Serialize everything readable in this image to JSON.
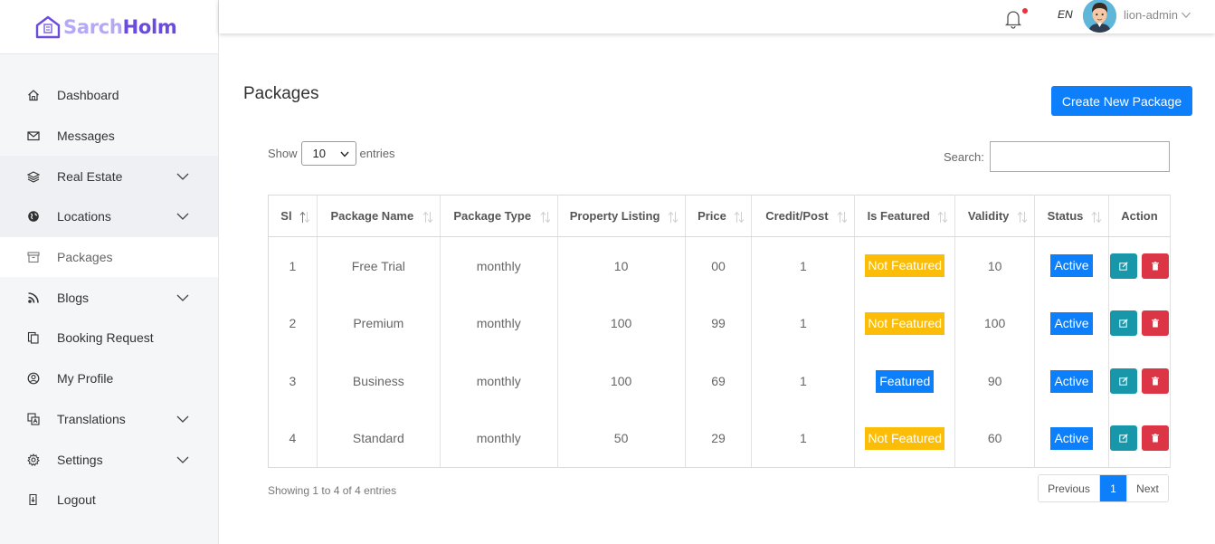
{
  "brand": {
    "part1": "Sarch",
    "part2": "Holm",
    "color_light": "#b5a9f5",
    "color_dark": "#6a4bdc"
  },
  "topbar": {
    "lang": "EN",
    "username": "lion-admin",
    "notification_dot_color": "#e8323c"
  },
  "sidebar": {
    "items": [
      {
        "label": "Dashboard",
        "icon": "home-icon",
        "has_submenu": false
      },
      {
        "label": "Messages",
        "icon": "mail-icon",
        "has_submenu": false
      },
      {
        "label": "Real Estate",
        "icon": "layers-icon",
        "has_submenu": true
      },
      {
        "label": "Locations",
        "icon": "globe-icon",
        "has_submenu": true
      },
      {
        "label": "Packages",
        "icon": "archive-icon",
        "has_submenu": false,
        "active": true
      },
      {
        "label": "Blogs",
        "icon": "rss-icon",
        "has_submenu": true
      },
      {
        "label": "Booking Request",
        "icon": "copy-icon",
        "has_submenu": false
      },
      {
        "label": "My Profile",
        "icon": "user-circle-icon",
        "has_submenu": false
      },
      {
        "label": "Translations",
        "icon": "translate-icon",
        "has_submenu": true
      },
      {
        "label": "Settings",
        "icon": "gear-icon",
        "has_submenu": true
      },
      {
        "label": "Logout",
        "icon": "logout-icon",
        "has_submenu": false
      }
    ]
  },
  "main": {
    "title": "Packages",
    "create_button": "Create New Package",
    "show_label": "Show",
    "page_size": "10",
    "entries_label": "entries",
    "search_label": "Search:",
    "search_value": "",
    "columns": [
      "Sl",
      "Package Name",
      "Package Type",
      "Property Listing",
      "Price",
      "Credit/Post",
      "Is Featured",
      "Validity",
      "Status",
      "Action"
    ],
    "rows": [
      {
        "sl": "1",
        "name": "Free Trial",
        "type": "monthly",
        "listing": "10",
        "price": "00",
        "credit": "1",
        "featured": "Not Featured",
        "validity": "10",
        "status": "Active"
      },
      {
        "sl": "2",
        "name": "Premium",
        "type": "monthly",
        "listing": "100",
        "price": "99",
        "credit": "1",
        "featured": "Not Featured",
        "validity": "100",
        "status": "Active"
      },
      {
        "sl": "3",
        "name": "Business",
        "type": "monthly",
        "listing": "100",
        "price": "69",
        "credit": "1",
        "featured": "Featured",
        "validity": "90",
        "status": "Active"
      },
      {
        "sl": "4",
        "name": "Standard",
        "type": "monthly",
        "listing": "50",
        "price": "29",
        "credit": "1",
        "featured": "Not Featured",
        "validity": "60",
        "status": "Active"
      }
    ],
    "info": "Showing 1 to 4 of 4 entries",
    "pagination": {
      "previous": "Previous",
      "current": "1",
      "next": "Next"
    },
    "colors": {
      "primary": "#0d7ffb",
      "warning": "#fbbd08",
      "edit": "#1797a9",
      "delete": "#dc3545"
    }
  }
}
